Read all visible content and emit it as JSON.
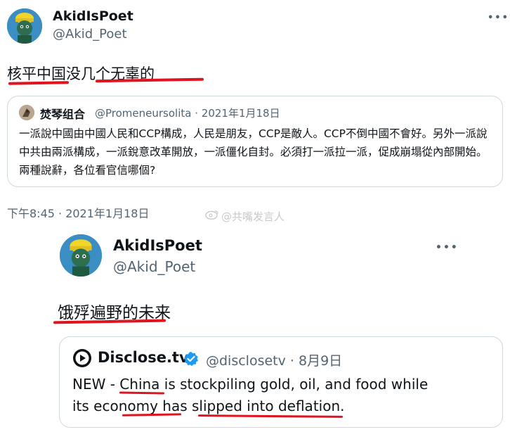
{
  "outer_tweet": {
    "display_name": "AkidIsPoet",
    "handle": "@Akid_Poet",
    "more_label": "•••",
    "text": "核平中国没几个无辜的"
  },
  "quoted_tweet_1": {
    "display_name": "焚琴组合",
    "handle": "@Promeneursolita",
    "date": "· 2021年1月18日",
    "body": "一派說中國由中國人民和CCP構成，人民是朋友，CCP是敵人。CCP不倒中國不會好。另外一派說中共由兩派構成，一派銳意改革開放，一派僵化自封。必須打一派拉一派，促成崩塌從內部開始。兩種說辭，各位看官信哪個?"
  },
  "timestamp": "下午8:45 · 2021年1月18日",
  "watermark": "@共嘴发言人",
  "inner_tweet": {
    "display_name": "AkidIsPoet",
    "handle": "@Akid_Poet",
    "more_label": "•••",
    "text": "饿殍遍野的未来"
  },
  "quoted_tweet_2": {
    "display_name": "Disclose.tv",
    "handle": "@disclosetv",
    "date": "· 8月9日",
    "body_line1": "NEW - China is stockpiling gold, oil, and food while",
    "body_line2": "its economy has slipped into deflation."
  },
  "colors": {
    "annotation_red": "#e0141e",
    "verified_blue": "#1d9bf0",
    "muted_text": "#536471"
  }
}
